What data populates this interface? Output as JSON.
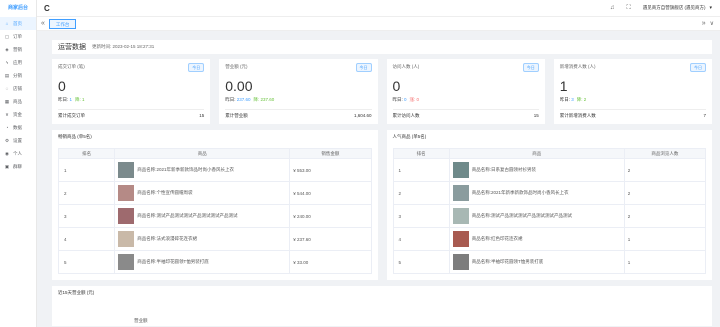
{
  "sidebar": {
    "title": "商家后台",
    "items": [
      {
        "icon": "home-icon",
        "glyph": "⌂",
        "label": "首页",
        "active": true
      },
      {
        "icon": "order-icon",
        "glyph": "▢",
        "label": "订单"
      },
      {
        "icon": "marketing-icon",
        "glyph": "◈",
        "label": "营销"
      },
      {
        "icon": "flash-icon",
        "glyph": "ϟ",
        "label": "应用"
      },
      {
        "icon": "assets-icon",
        "glyph": "▤",
        "label": "分销"
      },
      {
        "icon": "shop-icon",
        "glyph": "◌",
        "label": "店铺"
      },
      {
        "icon": "data-icon",
        "glyph": "▦",
        "label": "商品"
      },
      {
        "icon": "finance-icon",
        "glyph": "¥",
        "label": "资金"
      },
      {
        "icon": "stats-icon",
        "glyph": "◔",
        "label": "数据"
      },
      {
        "icon": "settings-icon",
        "glyph": "⚙",
        "label": "设置"
      },
      {
        "icon": "user-icon",
        "glyph": "◉",
        "label": "个人"
      },
      {
        "icon": "news-icon",
        "glyph": "▣",
        "label": "群聊"
      }
    ]
  },
  "topbar": {
    "refresh_glyph": "C",
    "bell_glyph": "♫",
    "fullscreen_glyph": "⛶",
    "user": "遇见商方自营旗舰店 (遇见商方)",
    "caret": "▾"
  },
  "tabs": {
    "left_glyph": "«",
    "active_tab": "工作台",
    "right_glyph": "»",
    "close_glyph": "∨"
  },
  "page": {
    "title": "运营数据",
    "update_time": "更新时间: 2023-02-15 18:27:31"
  },
  "cards": [
    {
      "title": "成交订单 (笔)",
      "tag": "今日",
      "value": "0",
      "sub_label": "昨日:",
      "sub_v1": "1",
      "sub_v2": "",
      "sub_v3": "降: 1",
      "foot_label": "累计成交订单",
      "foot_value": "15"
    },
    {
      "title": "营业额 (元)",
      "tag": "今日",
      "value": "0.00",
      "sub_label": "昨日:",
      "sub_v1": "237.60",
      "sub_v2": "",
      "sub_v3": "降: 237.60",
      "foot_label": "累计营业额",
      "foot_value": "1,604.60"
    },
    {
      "title": "访问人数 (人)",
      "tag": "今日",
      "value": "0",
      "sub_label": "昨日:",
      "sub_v1": "0",
      "sub_v2": "涨: 0",
      "sub_v3": "",
      "foot_label": "累计访问人数",
      "foot_value": "15"
    },
    {
      "title": "新增消费人数 (人)",
      "tag": "今日",
      "value": "1",
      "sub_label": "昨日:",
      "sub_v1": "3",
      "sub_v2": "",
      "sub_v3": "降: 2",
      "foot_label": "累计新增消费人数",
      "foot_value": "7"
    }
  ],
  "sales_table": {
    "title": "畅销商品 (单5名)",
    "headers": [
      "排名",
      "商品",
      "销售金额"
    ],
    "rows": [
      {
        "rank": "1",
        "name": "商品名称:2021年新季新款饰品时尚小香风长上衣",
        "value": "¥ 553.00",
        "img": "#7b8a8c"
      },
      {
        "rank": "2",
        "name": "商品名称:个性宣传圆帽周袋",
        "value": "¥ 544.00",
        "img": "#b58a86"
      },
      {
        "rank": "3",
        "name": "商品名称:测试产品测试测试产品测试测试产品测试",
        "value": "¥ 240.00",
        "img": "#9e6a6e"
      },
      {
        "rank": "4",
        "name": "商品名称:法式浪漫碎花连衣裙",
        "value": "¥ 237.60",
        "img": "#c9b9a8"
      },
      {
        "rank": "5",
        "name": "商品名称:半袖印花圆领T恤男装打底",
        "value": "¥ 33.00",
        "img": "#8a8a8a"
      }
    ]
  },
  "popular_table": {
    "title": "人气商品 (单5名)",
    "headers": [
      "排名",
      "商品",
      "商品浏览人数"
    ],
    "rows": [
      {
        "rank": "1",
        "name": "商品名称:日系复古圆领衬衫男装",
        "value": "2",
        "img": "#6f8a8a"
      },
      {
        "rank": "2",
        "name": "商品名称:2021年新季新款饰品时尚小香风长上衣",
        "value": "2",
        "img": "#8a9c9e"
      },
      {
        "rank": "3",
        "name": "商品名称:测试产品测试测试产品测试测试产品测试",
        "value": "2",
        "img": "#a8b8b4"
      },
      {
        "rank": "4",
        "name": "商品名称:红色印花连衣裙",
        "value": "1",
        "img": "#a85a50"
      },
      {
        "rank": "5",
        "name": "商品名称:半袖印花圆领T恤男装打底",
        "value": "1",
        "img": "#7d7d7d"
      }
    ]
  },
  "bottom": {
    "title": "近15天营业额 (元)",
    "legend": "营业额"
  },
  "colors": {
    "primary": "#409eff",
    "up": "#f56c6c",
    "down": "#67c23a"
  }
}
